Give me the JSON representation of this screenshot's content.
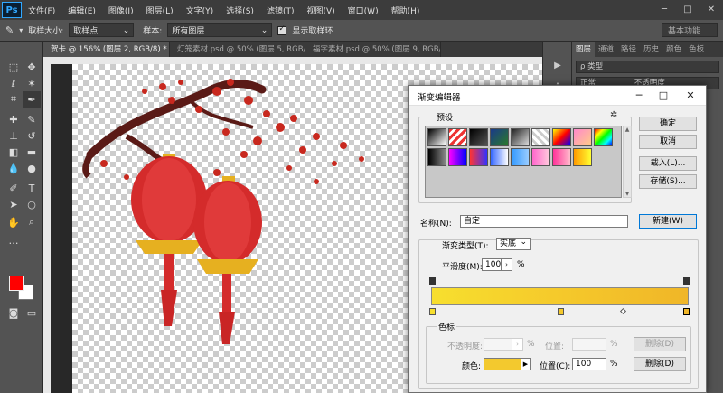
{
  "app": {
    "logo": "Ps"
  },
  "menu": [
    "文件(F)",
    "编辑(E)",
    "图像(I)",
    "图层(L)",
    "文字(Y)",
    "选择(S)",
    "滤镜(T)",
    "视图(V)",
    "窗口(W)",
    "帮助(H)"
  ],
  "window_controls": {
    "minimize": "─",
    "maximize": "□",
    "close": "✕"
  },
  "options": {
    "sample_size_label": "取样大小:",
    "sample_size_value": "取样点",
    "sample_label": "样本:",
    "sample_value": "所有图层",
    "show_ring_label": "显示取样环",
    "workspace": "基本功能"
  },
  "tabs": [
    "贺卡 @ 156% (图层 2, RGB/8) * ×",
    "灯笼素材.psd @ 50% (图层 5, RGB/8) ×",
    "福字素材.psd @ 50% (图层 9, RGB/8) ×"
  ],
  "panel": {
    "tabs": [
      "图层",
      "通道",
      "路径",
      "历史",
      "颜色",
      "色板"
    ],
    "kind_filter": "ρ 类型",
    "blend_mode": "正常",
    "opacity": "不透明度"
  },
  "colors": {
    "foreground": "#ff0000",
    "background": "#ffffff"
  },
  "dialog": {
    "title": "渐变编辑器",
    "controls": {
      "minimize": "─",
      "maximize": "□",
      "close": "✕"
    },
    "presets_label": "预设",
    "buttons": {
      "ok": "确定",
      "cancel": "取消",
      "load": "载入(L)...",
      "save": "存储(S)...",
      "new": "新建(W)"
    },
    "name_label": "名称(N):",
    "name_value": "自定",
    "gradient_type_label": "渐变类型(T):",
    "gradient_type_value": "实底",
    "smoothness_label": "平滑度(M):",
    "smoothness_value": "100",
    "smoothness_unit": "%",
    "stops": {
      "legend": "色标",
      "opacity_label": "不透明度:",
      "opacity_unit": "%",
      "opacity_location_label": "位置:",
      "opacity_location_unit": "%",
      "opacity_delete": "删除(D)",
      "color_label": "颜色:",
      "color_value": "#f3c92e",
      "color_location_label": "位置(C):",
      "color_location_value": "100",
      "color_location_unit": "%",
      "color_delete": "删除(D)"
    }
  }
}
